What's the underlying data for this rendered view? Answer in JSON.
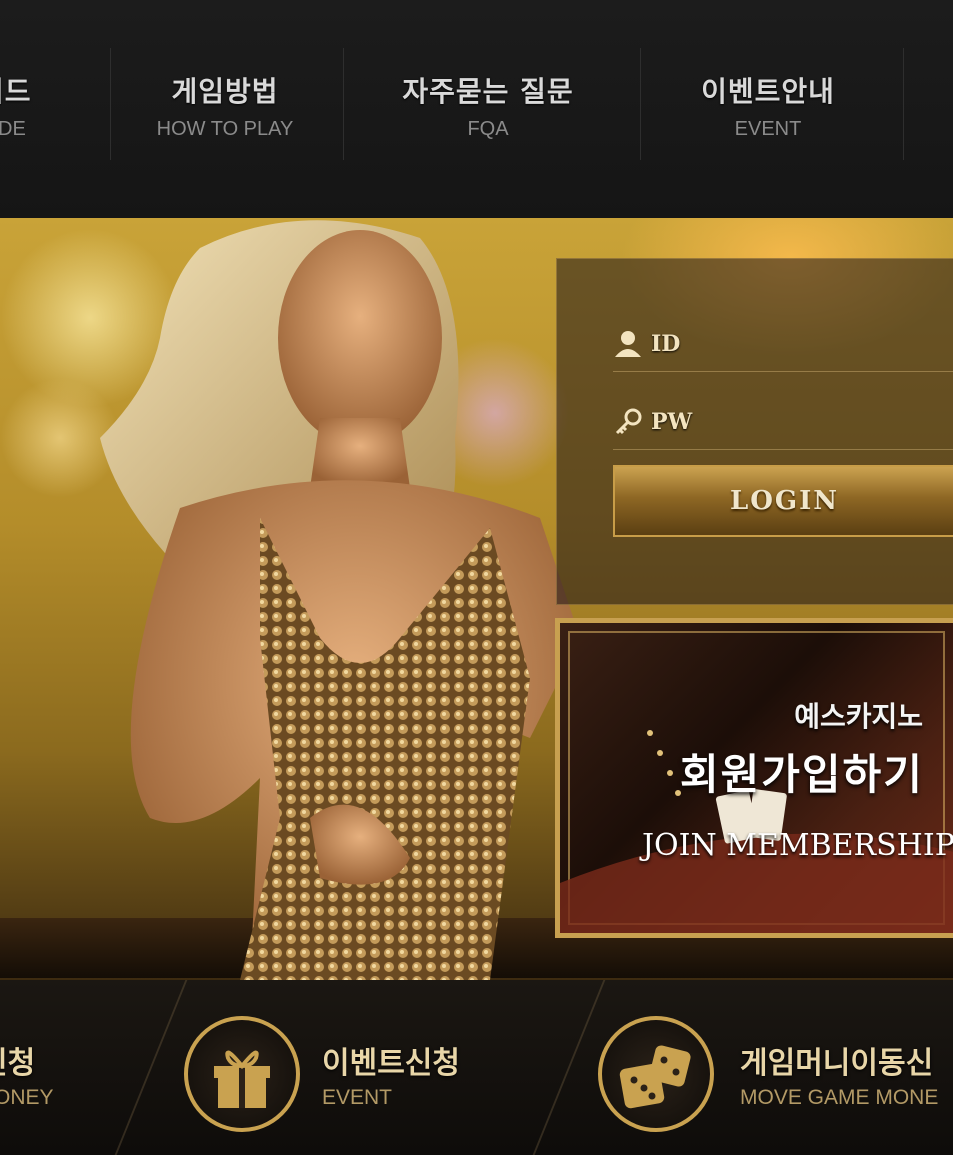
{
  "nav": {
    "items": [
      {
        "ko": "이드",
        "en": "UIDE"
      },
      {
        "ko": "게임방법",
        "en": "HOW TO PLAY"
      },
      {
        "ko": "자주묻는 질문",
        "en": "FQA"
      },
      {
        "ko": "이벤트안내",
        "en": "EVENT"
      }
    ]
  },
  "login": {
    "id_label": "ID",
    "pw_label": "PW",
    "button": "LOGIN"
  },
  "join": {
    "subtitle": "예스카지노",
    "title": "회원가입하기",
    "english": "JOIN MEMBERSHIP"
  },
  "bottom": {
    "items": [
      {
        "ko": "신청",
        "en": "ONEY",
        "icon": "money-icon"
      },
      {
        "ko": "이벤트신청",
        "en": "EVENT",
        "icon": "gift-icon"
      },
      {
        "ko": "게임머니이동신",
        "en": "MOVE GAME MONE",
        "icon": "dice-icon"
      }
    ]
  },
  "colors": {
    "gold": "#c9a250",
    "dark": "#141414"
  }
}
